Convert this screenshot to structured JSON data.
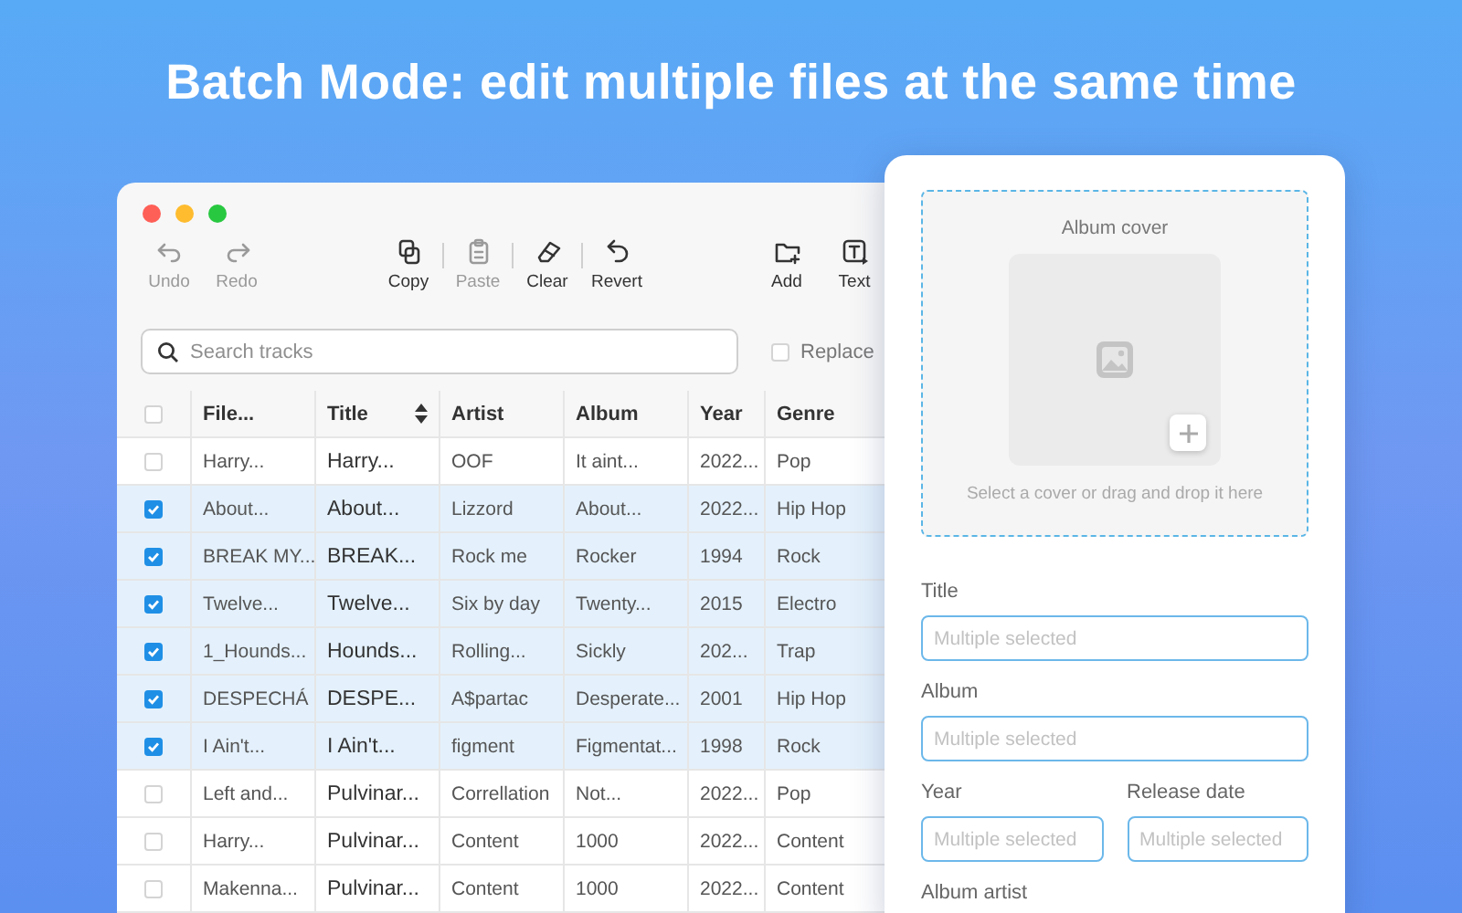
{
  "headline": "Batch Mode: edit multiple files at the same time",
  "toolbar": {
    "groups": [
      {
        "divided": false,
        "buttons": [
          {
            "kind": "undo",
            "label": "Undo",
            "disabled": true
          },
          {
            "kind": "redo",
            "label": "Redo",
            "disabled": true
          }
        ]
      },
      {
        "divided": true,
        "buttons": [
          {
            "kind": "copy",
            "label": "Copy",
            "disabled": false
          },
          {
            "kind": "paste",
            "label": "Paste",
            "disabled": true
          },
          {
            "kind": "clear",
            "label": "Clear",
            "disabled": false
          },
          {
            "kind": "revert",
            "label": "Revert",
            "disabled": false
          }
        ]
      },
      {
        "divided": false,
        "buttons": [
          {
            "kind": "add",
            "label": "Add",
            "disabled": false
          },
          {
            "kind": "text",
            "label": "Text",
            "disabled": false
          }
        ]
      }
    ]
  },
  "search": {
    "placeholder": "Search tracks"
  },
  "replace": {
    "label": "Replace",
    "checked": false
  },
  "table": {
    "all_checked": false,
    "columns": [
      {
        "label": "File...",
        "sorted": false
      },
      {
        "label": "Title",
        "sorted": true
      },
      {
        "label": "Artist",
        "sorted": false
      },
      {
        "label": "Album",
        "sorted": false
      },
      {
        "label": "Year",
        "sorted": false
      },
      {
        "label": "Genre",
        "sorted": false
      }
    ],
    "rows": [
      {
        "checked": false,
        "cells": [
          "Harry...",
          "Harry...",
          "OOF",
          "It aint...",
          "2022...",
          "Pop"
        ]
      },
      {
        "checked": true,
        "cells": [
          "About...",
          "About...",
          "Lizzord",
          "About...",
          "2022...",
          "Hip Hop"
        ]
      },
      {
        "checked": true,
        "cells": [
          "BREAK MY...",
          "BREAK...",
          "Rock me",
          "Rocker",
          "1994",
          "Rock"
        ]
      },
      {
        "checked": true,
        "cells": [
          "Twelve...",
          "Twelve...",
          "Six by day",
          "Twenty...",
          "2015",
          "Electro"
        ]
      },
      {
        "checked": true,
        "cells": [
          "1_Hounds...",
          "Hounds...",
          "Rolling...",
          "Sickly",
          "202...",
          "Trap"
        ]
      },
      {
        "checked": true,
        "cells": [
          "DESPECHÁ",
          "DESPE...",
          "A$partac",
          "Desperate...",
          "2001",
          "Hip Hop"
        ]
      },
      {
        "checked": true,
        "cells": [
          "I Ain't...",
          "I Ain't...",
          "figment",
          "Figmentat...",
          "1998",
          "Rock"
        ]
      },
      {
        "checked": false,
        "cells": [
          "Left and...",
          "Pulvinar...",
          "Correllation",
          "Not...",
          "2022...",
          "Pop"
        ]
      },
      {
        "checked": false,
        "cells": [
          "Harry...",
          "Pulvinar...",
          "Content",
          "1000",
          "2022...",
          "Content"
        ]
      },
      {
        "checked": false,
        "cells": [
          "Makenna...",
          "Pulvinar...",
          "Content",
          "1000",
          "2022...",
          "Content"
        ]
      }
    ]
  },
  "cover": {
    "title": "Album cover",
    "hint": "Select a cover or drag and drop it here"
  },
  "form": {
    "rows": [
      [
        {
          "label": "Title",
          "placeholder": "Multiple selected"
        }
      ],
      [
        {
          "label": "Album",
          "placeholder": "Multiple selected"
        }
      ],
      [
        {
          "label": "Year",
          "placeholder": "Multiple selected"
        },
        {
          "label": "Release date",
          "placeholder": "Multiple selected"
        }
      ],
      [
        {
          "label": "Album artist"
        }
      ]
    ]
  }
}
